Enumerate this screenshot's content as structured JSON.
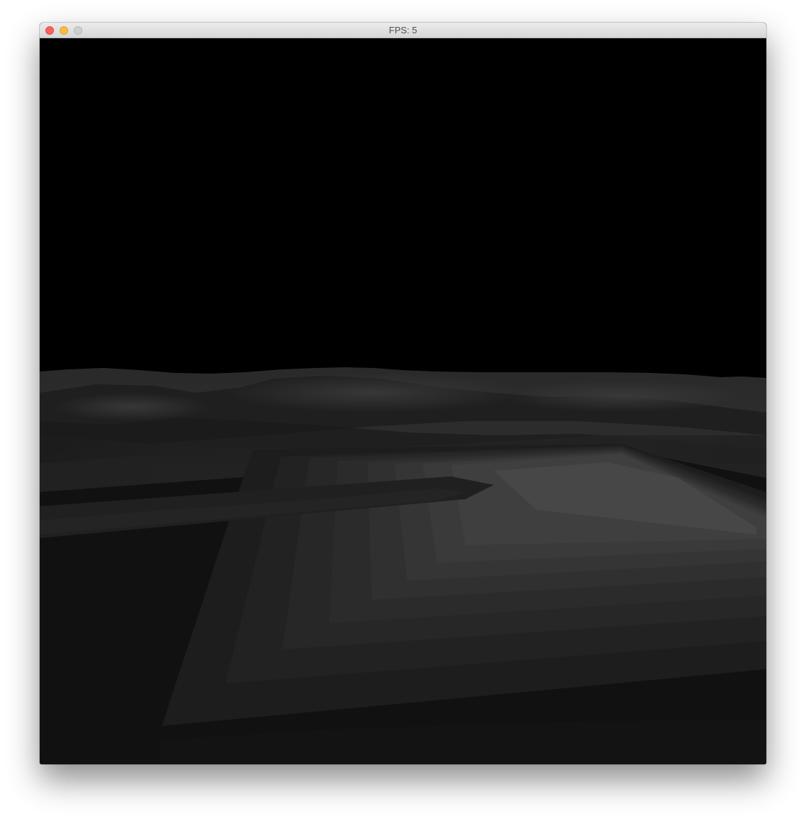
{
  "window": {
    "title": "FPS: 5",
    "controls": {
      "close": "close-button",
      "minimize": "minimize-button",
      "zoom": "zoom-button"
    }
  },
  "scene": {
    "sky_color": "#000000",
    "terrain_colors": [
      "#0e0e0e",
      "#141414",
      "#1b1b1b",
      "#232323",
      "#2b2b2b",
      "#343434",
      "#3e3e3e",
      "#474747"
    ]
  }
}
